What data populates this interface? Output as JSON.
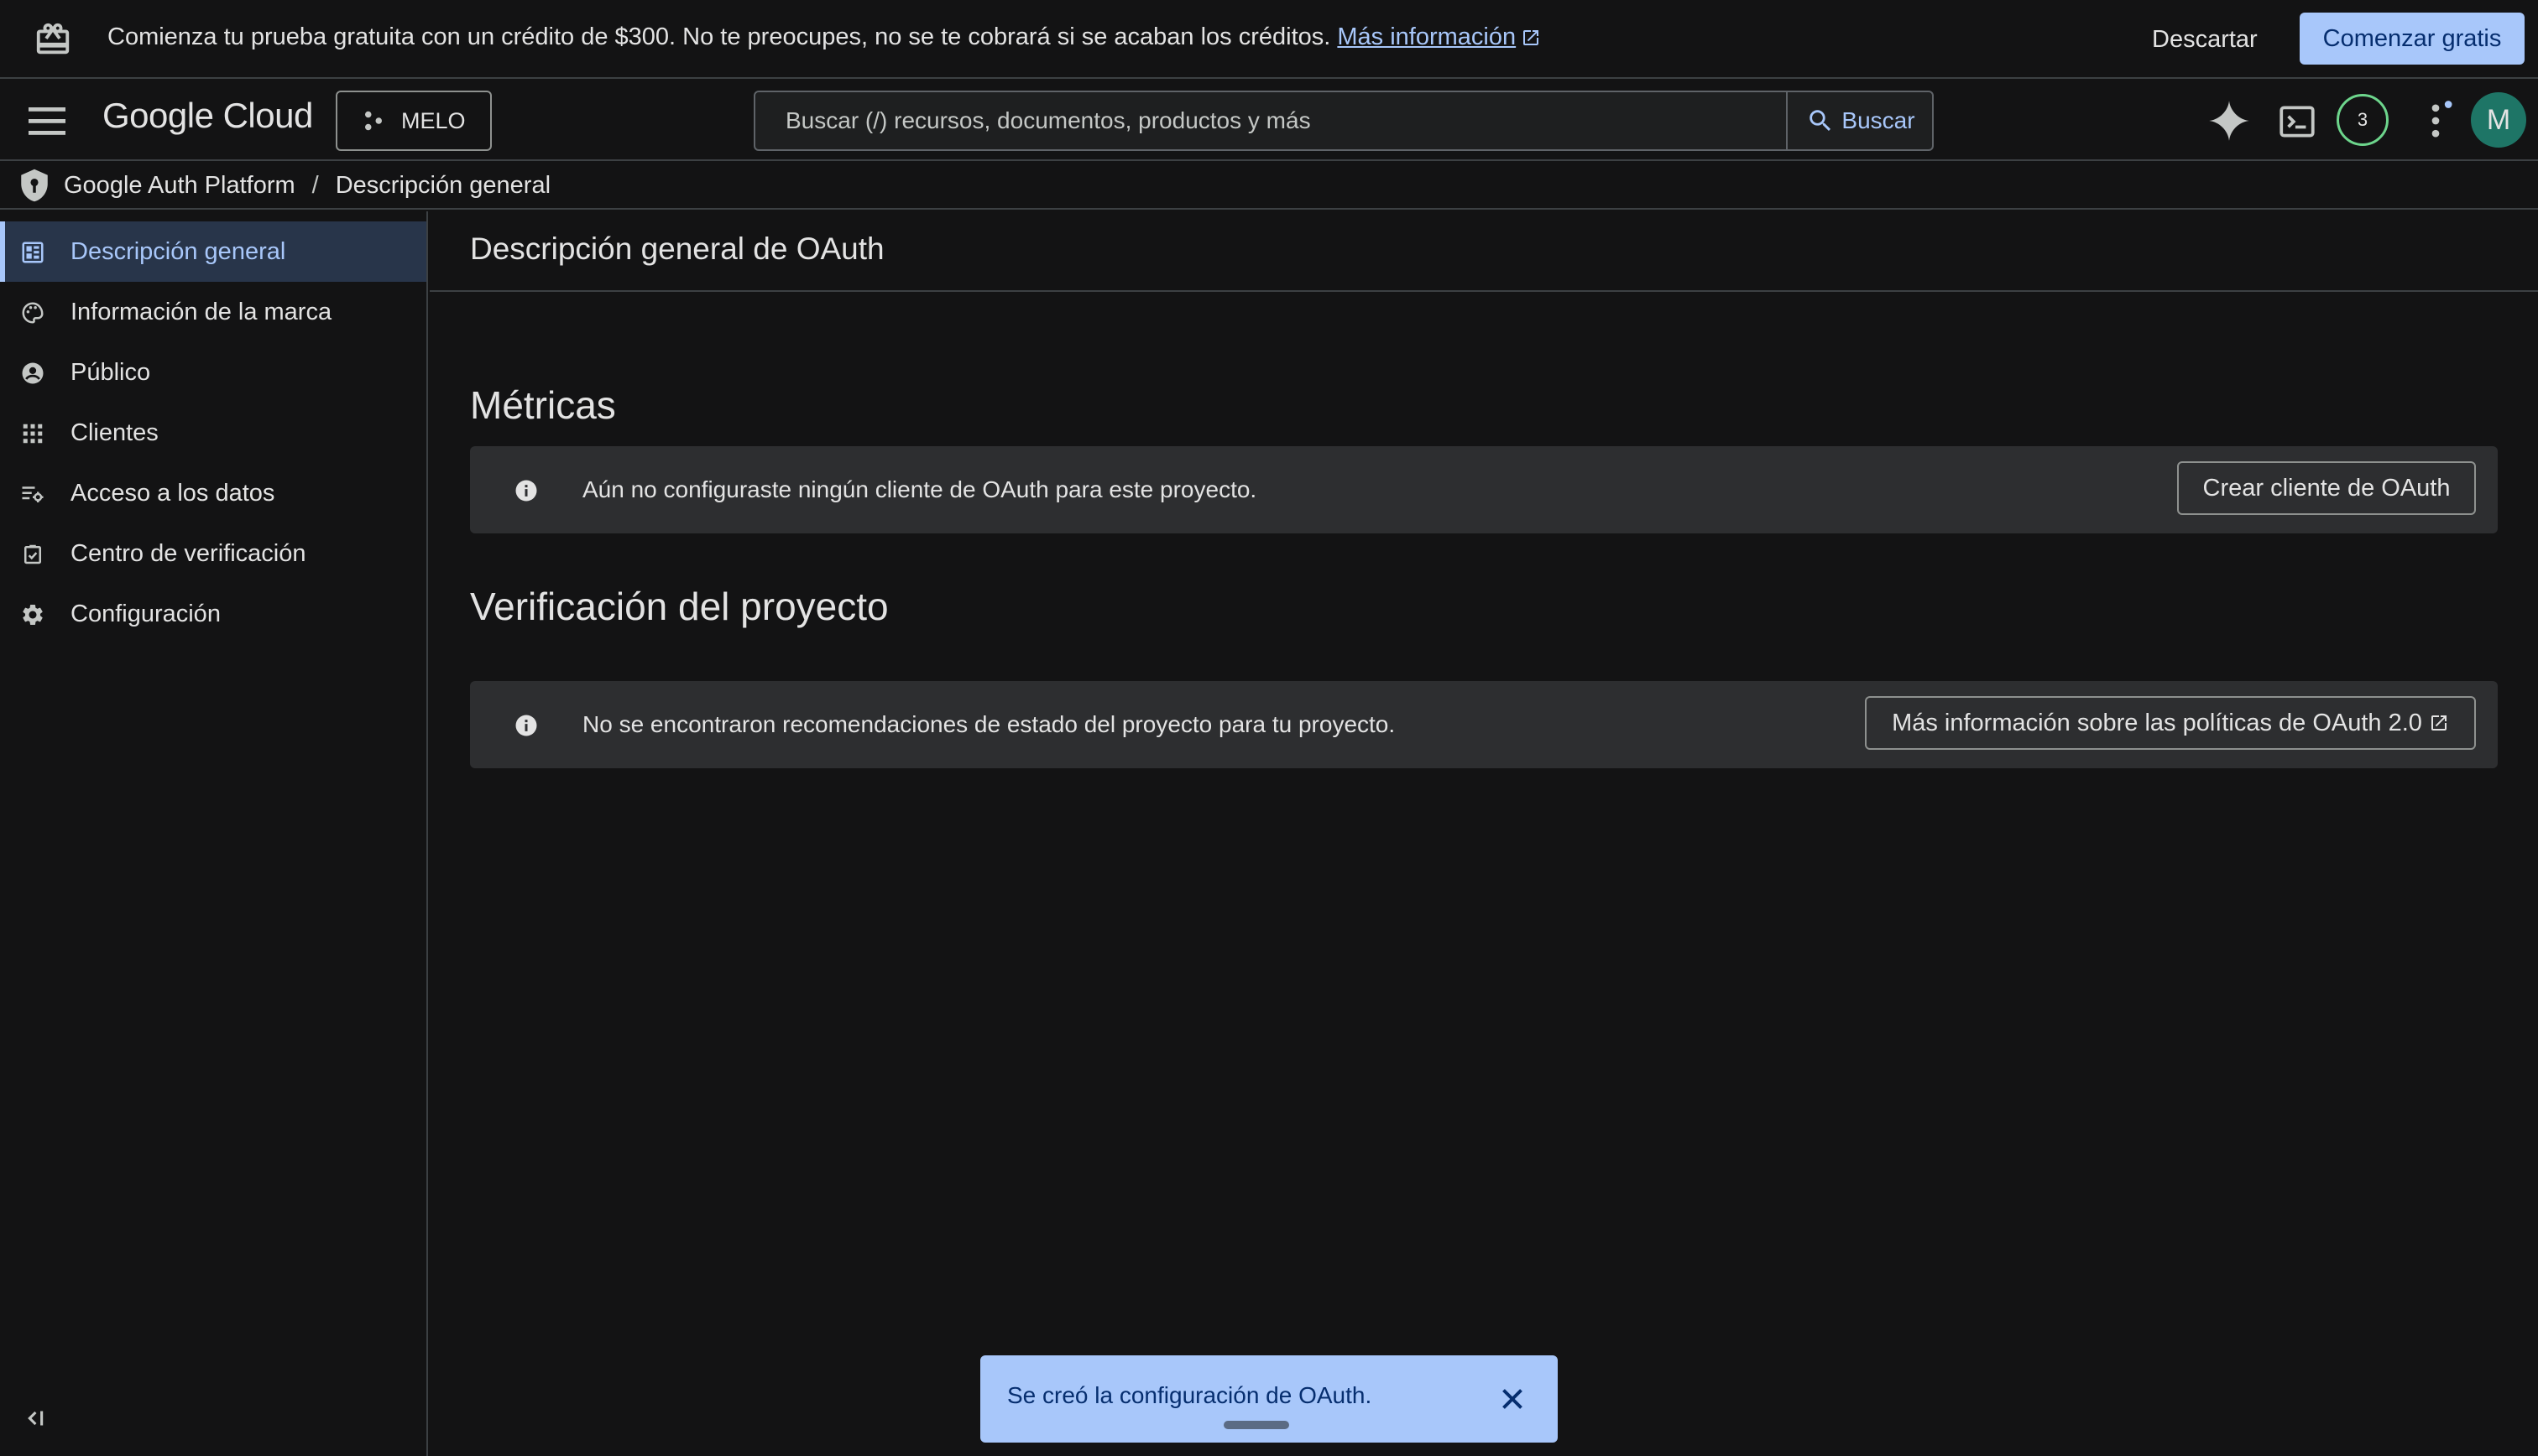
{
  "promo": {
    "message": "Comienza tu prueba gratuita con un crédito de $300. No te preocupes, no se te cobrará si se acaban los créditos.",
    "link": "Más información",
    "dismiss": "Descartar",
    "start": "Comenzar gratis"
  },
  "topbar": {
    "logo": "Google Cloud",
    "project": "MELO",
    "search_placeholder": "Buscar (/) recursos, documentos, productos y más",
    "search_button": "Buscar",
    "notifications": "3",
    "avatar": "M"
  },
  "breadcrumb": {
    "platform": "Google Auth Platform",
    "separator": "/",
    "current": "Descripción general"
  },
  "sidebar": {
    "items": [
      {
        "label": "Descripción general",
        "icon": "dashboard-icon",
        "active": true
      },
      {
        "label": "Información de la marca",
        "icon": "palette-icon"
      },
      {
        "label": "Público",
        "icon": "account-circle-icon"
      },
      {
        "label": "Clientes",
        "icon": "apps-grid-icon"
      },
      {
        "label": "Acceso a los datos",
        "icon": "data-access-icon"
      },
      {
        "label": "Centro de verificación",
        "icon": "verification-icon"
      },
      {
        "label": "Configuración",
        "icon": "gear-icon"
      }
    ]
  },
  "main": {
    "title": "Descripción general de OAuth",
    "metrics": {
      "title": "Métricas",
      "alert": "Aún no configuraste ningún cliente de OAuth para este proyecto.",
      "action": "Crear cliente de OAuth"
    },
    "verification": {
      "title": "Verificación del proyecto",
      "alert": "No se encontraron recomendaciones de estado del proyecto para tu proyecto.",
      "action": "Más información sobre las políticas de OAuth 2.0"
    }
  },
  "toast": {
    "message": "Se creó la configuración de OAuth."
  },
  "colors": {
    "background": "#131314",
    "accent": "#a8c7fa",
    "surface": "#2d2e30",
    "active_nav": "#28354a",
    "avatar": "#1e7566",
    "notification_ring": "#6dd58c"
  }
}
